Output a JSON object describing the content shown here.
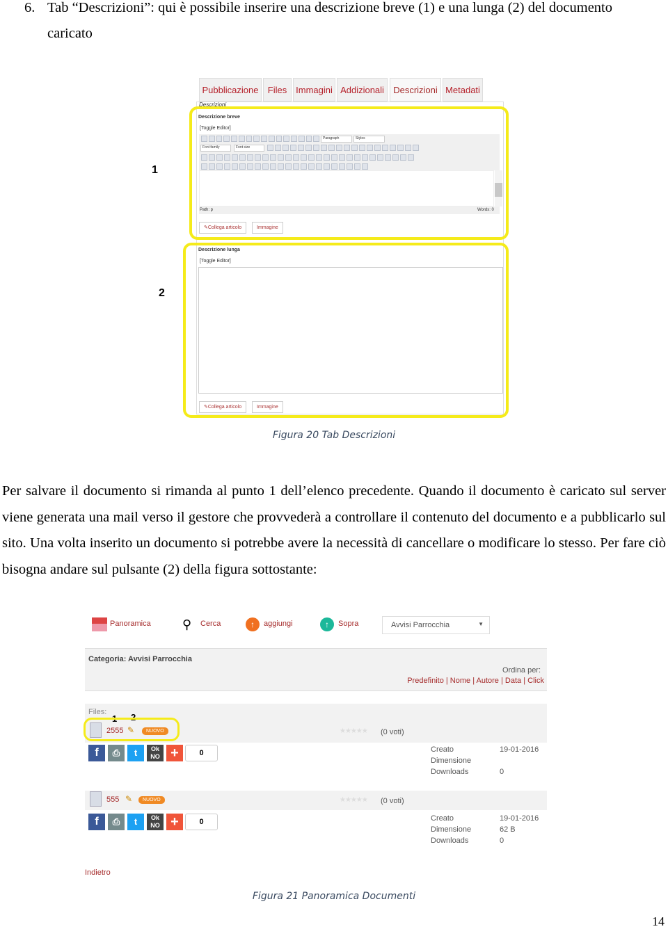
{
  "heading": {
    "number": "6.",
    "line1": "Tab “Descrizioni”: qui è possibile inserire una descrizione breve (1) e una lunga (2) del documento",
    "line2": "caricato"
  },
  "figure1": {
    "tabs": [
      "Pubblicazione",
      "Files",
      "Immagini",
      "Addizionali",
      "Descrizioni",
      "Metadati"
    ],
    "active_tab": "Descrizioni",
    "panel_title": "Descrizioni",
    "short": {
      "label": "Descrizione breve",
      "toggle": "[Toggle Editor]",
      "format_select": "Paragraph",
      "styles_select": "Styles",
      "font_family": "Font family",
      "font_size": "Font size",
      "path": "Path: p",
      "words": "Words: 0",
      "btn_link": "Collega articolo",
      "btn_image": "Immagine"
    },
    "long": {
      "label": "Descrizione lunga",
      "toggle": "[Toggle Editor]",
      "btn_link": "Collega articolo",
      "btn_image": "Immagine"
    },
    "marker1": "1",
    "marker2": "2",
    "caption": "Figura 20 Tab Descrizioni",
    "highlight_color": "#f5eb1a"
  },
  "paragraph": "Per salvare il documento si rimanda al punto 1 dell’elenco precedente. Quando il documento è caricato sul server viene generata una mail verso il gestore che provvederà a controllare il contenuto del documento e a pubblicarlo sul sito. Una volta inserito un documento si potrebbe avere la necessità di cancellare o modificare lo stesso. Per fare ciò bisogna andare sul pulsante (2) della figura sottostante:",
  "figure2": {
    "nav": [
      "Panoramica",
      "Cerca",
      "aggiungi",
      "Sopra"
    ],
    "category_select": "Avvisi Parrocchia",
    "category": "Categoria: Avvisi Parrocchia",
    "order_label": "Ordina per:",
    "order_links": [
      "Predefinito",
      "Nome",
      "Autore",
      "Data",
      "Click"
    ],
    "files_label": "Files:",
    "markers": [
      "1",
      "2"
    ],
    "files": [
      {
        "name": "2555",
        "badge": "NUOVO",
        "votes": "(0 voti)",
        "count": "0",
        "meta": [
          [
            "Creato",
            "19-01-2016"
          ],
          [
            "Dimensione",
            ""
          ],
          [
            "Downloads",
            "0"
          ]
        ]
      },
      {
        "name": "555",
        "badge": "NUOVO",
        "votes": "(0 voti)",
        "count": "0",
        "meta": [
          [
            "Creato",
            "19-01-2016"
          ],
          [
            "Dimensione",
            "62 B"
          ],
          [
            "Downloads",
            "0"
          ]
        ]
      }
    ],
    "back": "Indietro",
    "caption": "Figura 21 Panoramica Documenti"
  },
  "page_number": "14"
}
